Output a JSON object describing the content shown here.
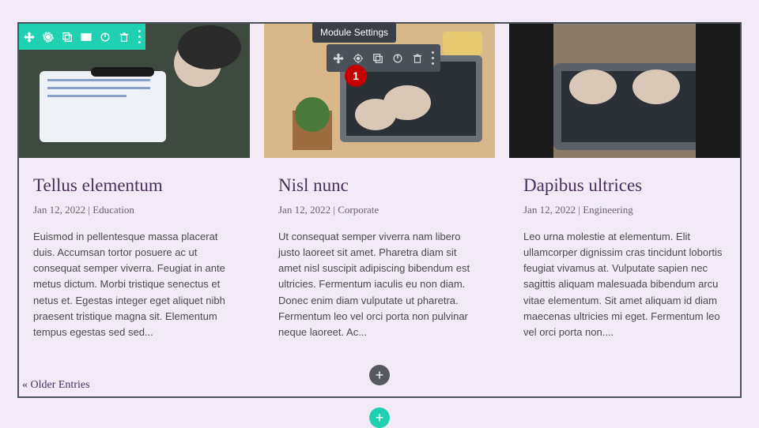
{
  "tooltip": "Module Settings",
  "callout": "1",
  "row_toolbar": {
    "icons": [
      "move",
      "gear",
      "duplicate",
      "columns",
      "power",
      "trash",
      "more"
    ]
  },
  "mod_toolbar": {
    "icons": [
      "move",
      "gear",
      "duplicate",
      "power",
      "trash",
      "more"
    ]
  },
  "cards": [
    {
      "title": "Tellus elementum",
      "date": "Jan 12, 2022",
      "category": "Education",
      "excerpt": "Euismod in pellentesque massa placerat duis. Accumsan tortor posuere ac ut consequat semper viverra. Feugiat in ante metus dictum. Morbi tristique senectus et netus et. Egestas integer eget aliquet nibh praesent tristique magna sit. Elementum tempus egestas sed sed..."
    },
    {
      "title": "Nisl nunc",
      "date": "Jan 12, 2022",
      "category": "Corporate",
      "excerpt": "Ut consequat semper viverra nam libero justo laoreet sit amet. Pharetra diam sit amet nisl suscipit adipiscing bibendum est ultricies. Fermentum iaculis eu non diam. Donec enim diam vulputate ut pharetra. Fermentum leo vel orci porta non pulvinar neque laoreet. Ac..."
    },
    {
      "title": "Dapibus ultrices",
      "date": "Jan 12, 2022",
      "category": "Engineering",
      "excerpt": "Leo urna molestie at elementum. Elit ullamcorper dignissim cras tincidunt lobortis feugiat vivamus at. Vulputate sapien nec sagittis aliquam malesuada bibendum arcu vitae elementum. Sit amet aliquam id diam maecenas ultricies mi eget. Fermentum leo vel orci porta non...."
    }
  ],
  "pager": "« Older Entries",
  "add_label": "+"
}
